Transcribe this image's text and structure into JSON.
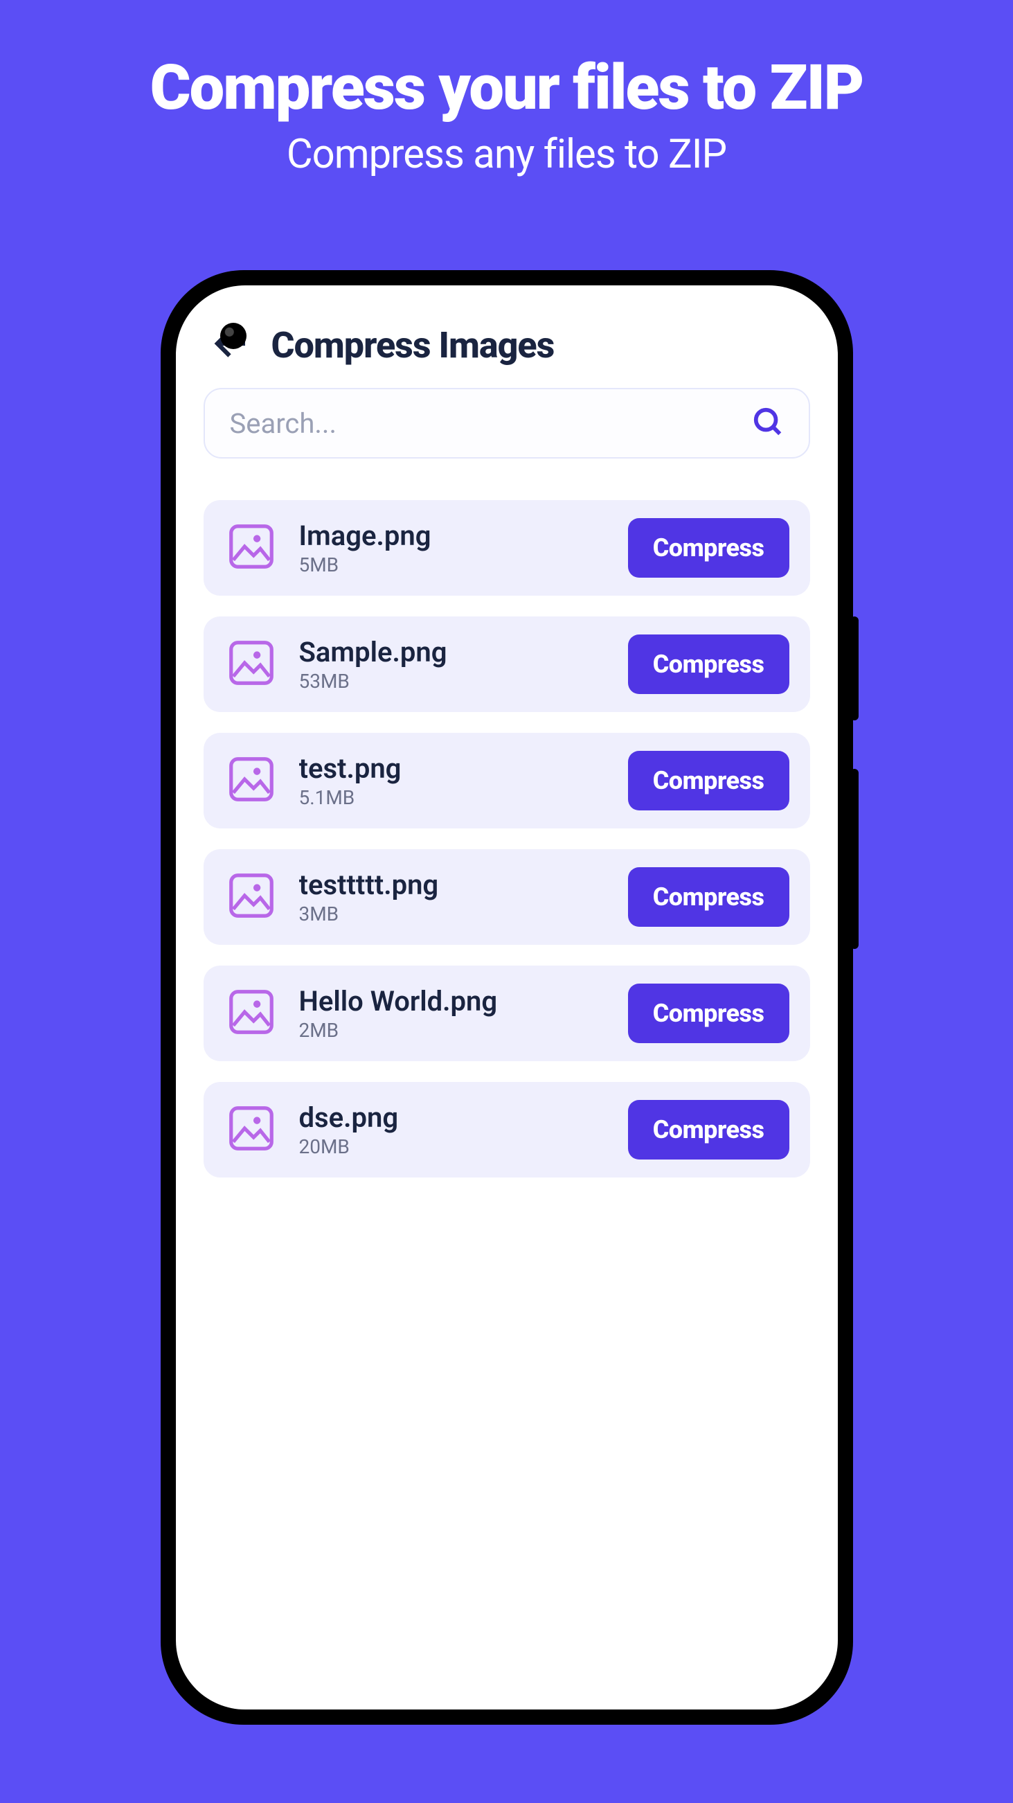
{
  "hero": {
    "title": "Compress your files to ZIP",
    "subtitle": "Compress any files to ZIP"
  },
  "page": {
    "title": "Compress Images"
  },
  "search": {
    "placeholder": "Search..."
  },
  "action_label": "Compress",
  "files": [
    {
      "name": "Image.png",
      "size": "5MB"
    },
    {
      "name": "Sample.png",
      "size": "53MB"
    },
    {
      "name": "test.png",
      "size": "5.1MB"
    },
    {
      "name": "testtttt.png",
      "size": "3MB"
    },
    {
      "name": "Hello World.png",
      "size": "2MB"
    },
    {
      "name": "dse.png",
      "size": "20MB"
    }
  ]
}
